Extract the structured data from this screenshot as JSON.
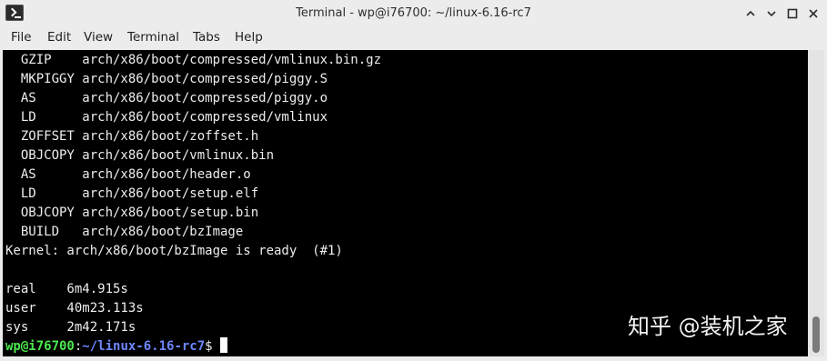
{
  "window": {
    "title": "Terminal - wp@i76700: ~/linux-6.16-rc7",
    "app_icon": "terminal-icon",
    "controls": {
      "minimize": "minimize-icon",
      "restore": "restore-icon",
      "maximize": "maximize-icon",
      "close": "close-icon"
    }
  },
  "menubar": {
    "items": [
      "File",
      "Edit",
      "View",
      "Terminal",
      "Tabs",
      "Help"
    ]
  },
  "terminal": {
    "lines": [
      "  GZIP    arch/x86/boot/compressed/vmlinux.bin.gz",
      "  MKPIGGY arch/x86/boot/compressed/piggy.S",
      "  AS      arch/x86/boot/compressed/piggy.o",
      "  LD      arch/x86/boot/compressed/vmlinux",
      "  ZOFFSET arch/x86/boot/zoffset.h",
      "  OBJCOPY arch/x86/boot/vmlinux.bin",
      "  AS      arch/x86/boot/header.o",
      "  LD      arch/x86/boot/setup.elf",
      "  OBJCOPY arch/x86/boot/setup.bin",
      "  BUILD   arch/x86/boot/bzImage",
      "Kernel: arch/x86/boot/bzImage is ready  (#1)",
      "",
      "real    6m4.915s",
      "user    40m23.113s",
      "sys     2m42.171s"
    ],
    "prompt": {
      "user_host": "wp@i76700",
      "separator": ":",
      "path": "~/linux-6.16-rc7",
      "symbol": "$"
    },
    "colors": {
      "background": "#000000",
      "foreground": "#ededed",
      "prompt_user": "#4ce84c",
      "prompt_path": "#6e86ff"
    }
  },
  "watermark": {
    "text": "知乎 @装机之家"
  }
}
